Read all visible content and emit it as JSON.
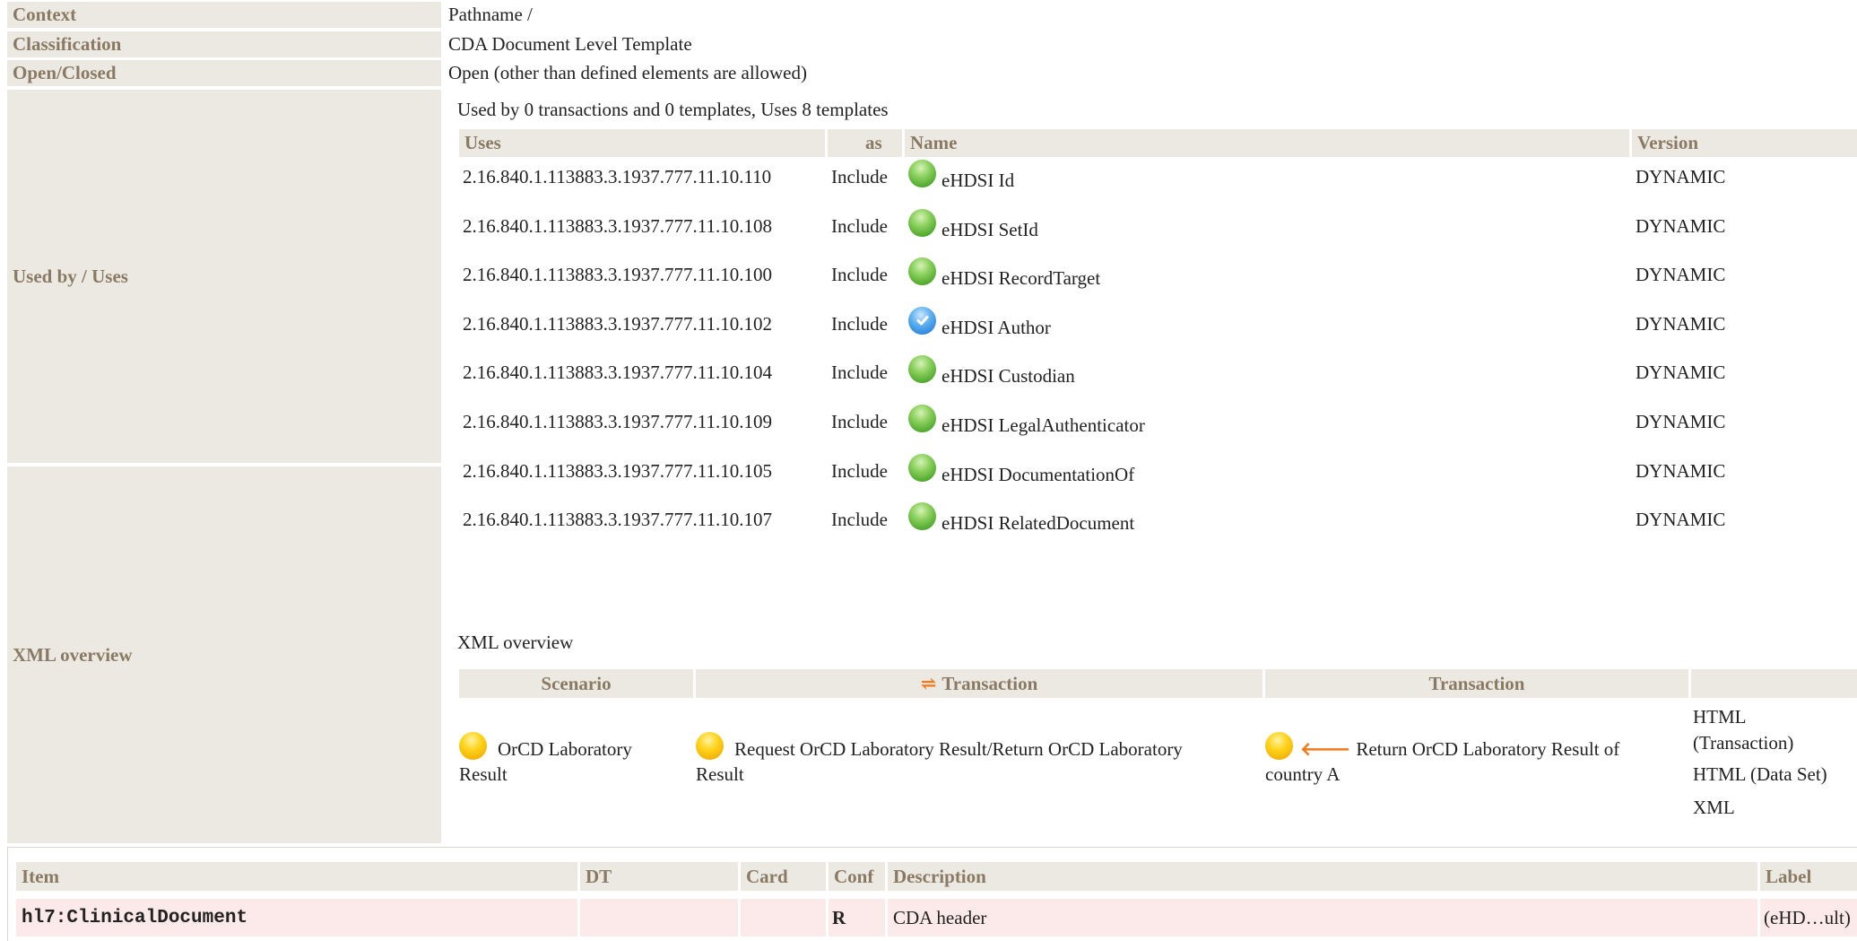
{
  "rows": {
    "context": {
      "label": "Context",
      "value": "Pathname /"
    },
    "classification": {
      "label": "Classification",
      "value": "CDA Document Level Template"
    },
    "open_closed": {
      "label": "Open/Closed",
      "value": "Open (other than defined elements are allowed)"
    },
    "used_by": {
      "label": "Used by / Uses"
    },
    "xml": {
      "label": "XML overview"
    }
  },
  "uses": {
    "summary": "Used by 0 transactions and 0 templates, Uses 8 templates",
    "headers": {
      "uses": "Uses",
      "as": "as",
      "name": "Name",
      "version": "Version"
    },
    "items": [
      {
        "id": "2.16.840.1.113883.3.1937.777.11.10.110",
        "as": "Include",
        "status": "green",
        "name": "eHDSI Id",
        "version": "DYNAMIC"
      },
      {
        "id": "2.16.840.1.113883.3.1937.777.11.10.108",
        "as": "Include",
        "status": "green",
        "name": "eHDSI SetId",
        "version": "DYNAMIC"
      },
      {
        "id": "2.16.840.1.113883.3.1937.777.11.10.100",
        "as": "Include",
        "status": "green",
        "name": "eHDSI RecordTarget",
        "version": "DYNAMIC"
      },
      {
        "id": "2.16.840.1.113883.3.1937.777.11.10.102",
        "as": "Include",
        "status": "blue",
        "name": "eHDSI Author",
        "version": "DYNAMIC"
      },
      {
        "id": "2.16.840.1.113883.3.1937.777.11.10.104",
        "as": "Include",
        "status": "green",
        "name": "eHDSI Custodian",
        "version": "DYNAMIC"
      },
      {
        "id": "2.16.840.1.113883.3.1937.777.11.10.109",
        "as": "Include",
        "status": "green",
        "name": "eHDSI LegalAuthenticator",
        "version": "DYNAMIC"
      },
      {
        "id": "2.16.840.1.113883.3.1937.777.11.10.105",
        "as": "Include",
        "status": "green",
        "name": "eHDSI DocumentationOf",
        "version": "DYNAMIC"
      },
      {
        "id": "2.16.840.1.113883.3.1937.777.11.10.107",
        "as": "Include",
        "status": "green",
        "name": "eHDSI RelatedDocument",
        "version": "DYNAMIC"
      }
    ]
  },
  "xml_overview": {
    "title": "XML overview",
    "headers": {
      "scenario": "Scenario",
      "transaction1": "Transaction",
      "transaction2": "Transaction"
    },
    "scenario_line1": "OrCD Laboratory",
    "scenario_line2": "Result",
    "tx1_line1": "Request OrCD Laboratory Result/Return OrCD Laboratory",
    "tx1_line2": "Result",
    "tx2_line1": "Return OrCD Laboratory Result of",
    "tx2_line2": "country A",
    "links": {
      "html_tx_1": "HTML",
      "html_tx_2": "(Transaction)",
      "html_ds": "HTML (Data Set)",
      "xml": "XML"
    }
  },
  "items_table": {
    "headers": {
      "item": "Item",
      "dt": "DT",
      "card": "Card",
      "conf": "Conf",
      "description": "Description",
      "label": "Label"
    },
    "rows": [
      {
        "item": "hl7:ClinicalDocument",
        "dt": "",
        "card": "",
        "conf": "R",
        "description": "CDA header",
        "label": "(eHD…ult)"
      }
    ]
  },
  "colors": {
    "label_bg": "#ece9e3",
    "label_text": "#8a7a63",
    "row_pink": "#fce9e9",
    "status_green": "#4aa52a",
    "status_blue": "#1f7bd6",
    "status_yellow": "#ffd21a",
    "arrow_orange": "#f07a1a"
  }
}
